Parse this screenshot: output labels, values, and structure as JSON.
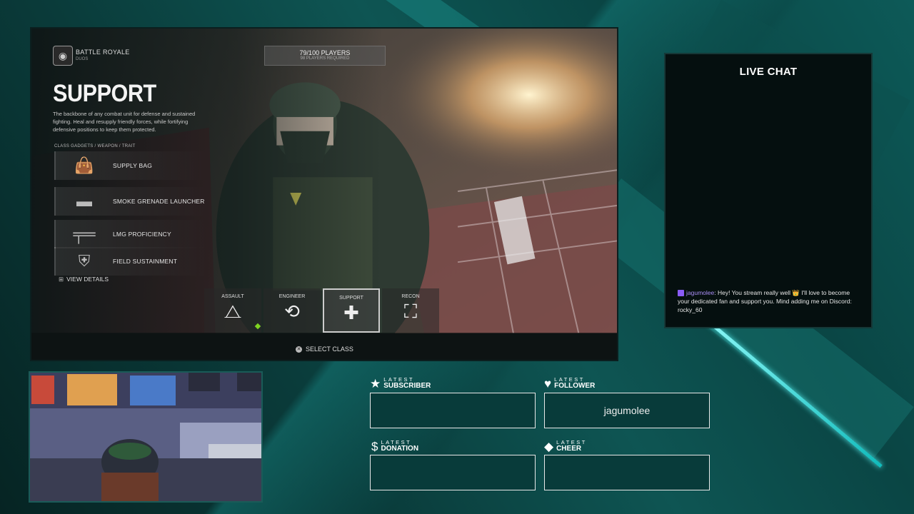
{
  "game": {
    "mode_title": "BATTLE ROYALE",
    "mode_sub": "DUOS",
    "players_count": "79/100 PLAYERS",
    "players_required": "98 PLAYERS REQUIRED",
    "class_title": "SUPPORT",
    "class_desc": "The backbone of any combat unit for defense and sustained fighting. Heal and resupply friendly forces, while fortifying defensive positions to keep them protected.",
    "gadgets_label": "CLASS GADGETS / WEAPON / TRAIT",
    "gadgets": [
      {
        "label": "SUPPLY BAG",
        "icon": "supply-bag-icon"
      },
      {
        "label": "SMOKE GRENADE LAUNCHER",
        "icon": "grenade-launcher-icon"
      },
      {
        "label": "LMG PROFICIENCY",
        "icon": "lmg-icon"
      },
      {
        "label": "FIELD SUSTAINMENT",
        "icon": "field-sustainment-icon"
      }
    ],
    "view_details": "VIEW DETAILS",
    "class_tabs": [
      {
        "label": "ASSAULT",
        "icon": "assault-icon"
      },
      {
        "label": "ENGINEER",
        "icon": "engineer-icon"
      },
      {
        "label": "SUPPORT",
        "icon": "support-icon"
      },
      {
        "label": "RECON",
        "icon": "recon-icon"
      }
    ],
    "selected_class": "SUPPORT",
    "select_class": "SELECT CLASS"
  },
  "chat": {
    "title": "LIVE CHAT",
    "messages": [
      {
        "user": "jagumolee",
        "text": "Hey! You stream really well 👑 I'll love to become your dedicated fan and support you. Mind adding me on Discord: rocky_60"
      }
    ]
  },
  "stats": {
    "subscriber": {
      "t1": "LATEST",
      "t2": "SUBSCRIBER",
      "value": ""
    },
    "follower": {
      "t1": "LATEST",
      "t2": "FOLLOWER",
      "value": "jagumolee"
    },
    "donation": {
      "t1": "LATEST",
      "t2": "DONATION",
      "value": ""
    },
    "cheer": {
      "t1": "LATEST",
      "t2": "CHEER",
      "value": ""
    }
  },
  "colors": {
    "accent": "#0e5553",
    "chat_user": "#a98ef5",
    "active_dot": "#7ed321"
  }
}
